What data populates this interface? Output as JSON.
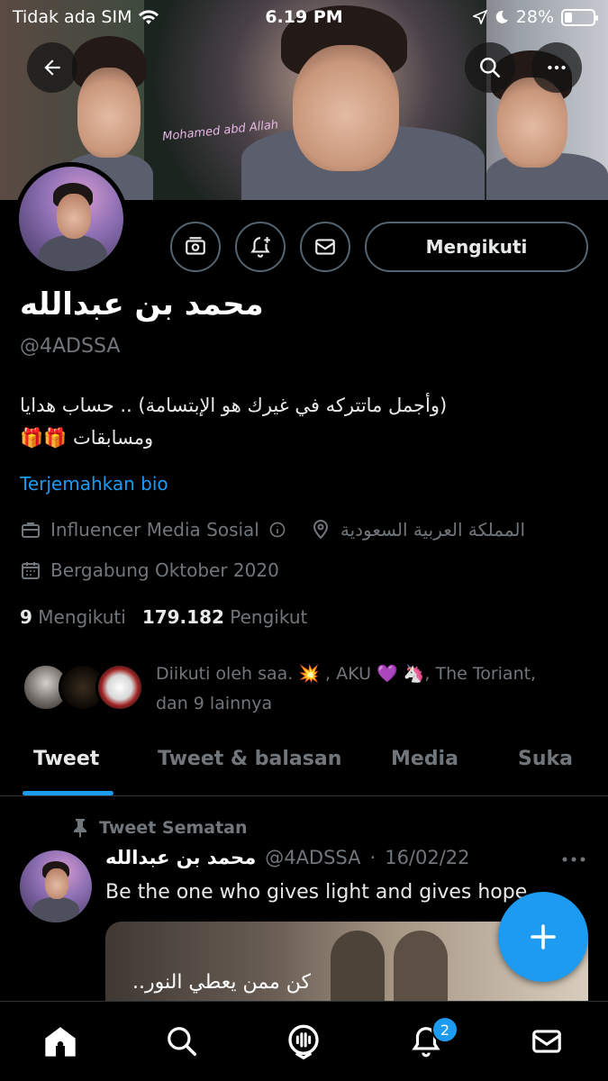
{
  "status_bar": {
    "carrier": "Tidak ada SIM",
    "time": "6.19 PM",
    "battery": "28%",
    "battery_level": 0.28
  },
  "banner": {
    "caption": "Mohamed abd Allah"
  },
  "profile": {
    "name": "محمد بن عبدالله",
    "handle": "@4ADSSA",
    "bio_line1": "(وأجمل ماتتركه في غيرك هو الإبتسامة) .. حساب هدايا",
    "bio_line2": "ومسابقات 🎁🎁",
    "translate_label": "Terjemahkan bio",
    "category": "Influencer Media Sosial",
    "location": "المملكة العربية السعودية",
    "joined": "Bergabung Oktober 2020",
    "following_count": "9",
    "following_label": "Mengikuti",
    "followers_count": "179.182",
    "followers_label": "Pengikut",
    "followed_by_line1": "Diikuti oleh saa. 💥 , AKU 💜 🦄, The Toriant,",
    "followed_by_line2": "dan 9 lainnya",
    "follow_button": "Mengikuti"
  },
  "tabs": [
    "Tweet",
    "Tweet & balasan",
    "Media",
    "Suka"
  ],
  "tweet": {
    "pinned_label": "Tweet Sematan",
    "author": "محمد بن عبدالله",
    "handle": "@4ADSSA",
    "separator": "·",
    "date": "16/02/22",
    "text": "Be the one who gives light and gives hope",
    "media_text": "كن ممن يعطي النور.."
  },
  "notifications_badge": "2",
  "icons": {
    "back": "arrow-left-icon",
    "search": "search-icon",
    "more": "more-icon",
    "tip": "money-icon",
    "notify": "bell-plus-icon",
    "message": "mail-icon",
    "home": "home-icon",
    "explore": "search-icon",
    "spaces": "spaces-icon",
    "notifications": "bell-icon",
    "messages": "mail-icon"
  },
  "colors": {
    "accent": "#1d9bf0",
    "background": "#000000",
    "secondary_text": "#71767b",
    "border": "#2f3336"
  }
}
